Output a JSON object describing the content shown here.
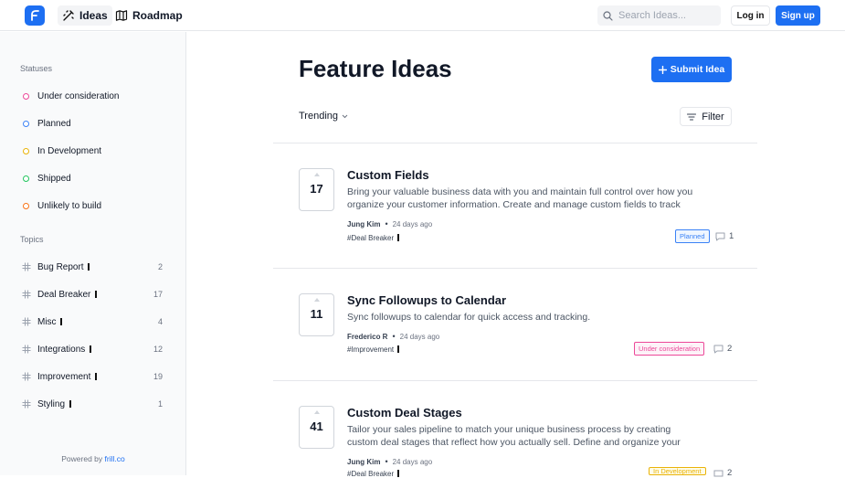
{
  "header": {
    "tabs": [
      {
        "label": "Ideas",
        "icon": "ideas-icon",
        "active": true
      },
      {
        "label": "Roadmap",
        "icon": "map-icon",
        "active": false
      }
    ],
    "search_placeholder": "Search Ideas...",
    "login_label": "Log in",
    "signup_label": "Sign up",
    "accent_color": "#1d6ff2"
  },
  "sidebar": {
    "statuses_heading": "Statuses",
    "statuses": [
      {
        "label": "Under consideration",
        "color": "#ec4899"
      },
      {
        "label": "Planned",
        "color": "#3b82f6"
      },
      {
        "label": "In Development",
        "color": "#eab308"
      },
      {
        "label": "Shipped",
        "color": "#22c55e"
      },
      {
        "label": "Unlikely to build",
        "color": "#f97316"
      }
    ],
    "topics_heading": "Topics",
    "topics": [
      {
        "label": "Bug Report",
        "count": "2"
      },
      {
        "label": "Deal Breaker",
        "count": "17"
      },
      {
        "label": "Misc",
        "count": "4"
      },
      {
        "label": "Integrations",
        "count": "12"
      },
      {
        "label": "Improvement",
        "count": "19"
      },
      {
        "label": "Styling",
        "count": "1"
      }
    ],
    "powered_prefix": "Powered by ",
    "powered_link": "frill.co"
  },
  "main": {
    "title": "Feature Ideas",
    "submit_label": "Submit Idea",
    "sort_label": "Trending",
    "filter_label": "Filter"
  },
  "posts": [
    {
      "votes": "17",
      "title": "Custom Fields",
      "description": "Bring your valuable business data with you and maintain full control over how you organize your customer information. Create and manage custom fields to track the...",
      "author": "Jung Kim",
      "time": "24 days ago",
      "tag": "#Deal Breaker",
      "status": "Planned",
      "status_color": "#3b82f6",
      "comments": "1"
    },
    {
      "votes": "11",
      "title": "Sync Followups to Calendar",
      "description": "Sync followups to calendar for quick access and tracking.",
      "author": "Frederico R",
      "time": "24 days ago",
      "tag": "#Improvement",
      "status": "Under consideration",
      "status_color": "#ec4899",
      "comments": "2"
    },
    {
      "votes": "41",
      "title": "Custom Deal Stages",
      "description": "Tailor your sales pipeline to match your unique business process by creating custom deal stages that reflect how you actually sell. Define and organize your sales pipelin...",
      "author": "Jung Kim",
      "time": "24 days ago",
      "tag": "#Deal Breaker",
      "status": "In Development",
      "status_color": "#eab308",
      "comments": "2"
    }
  ]
}
